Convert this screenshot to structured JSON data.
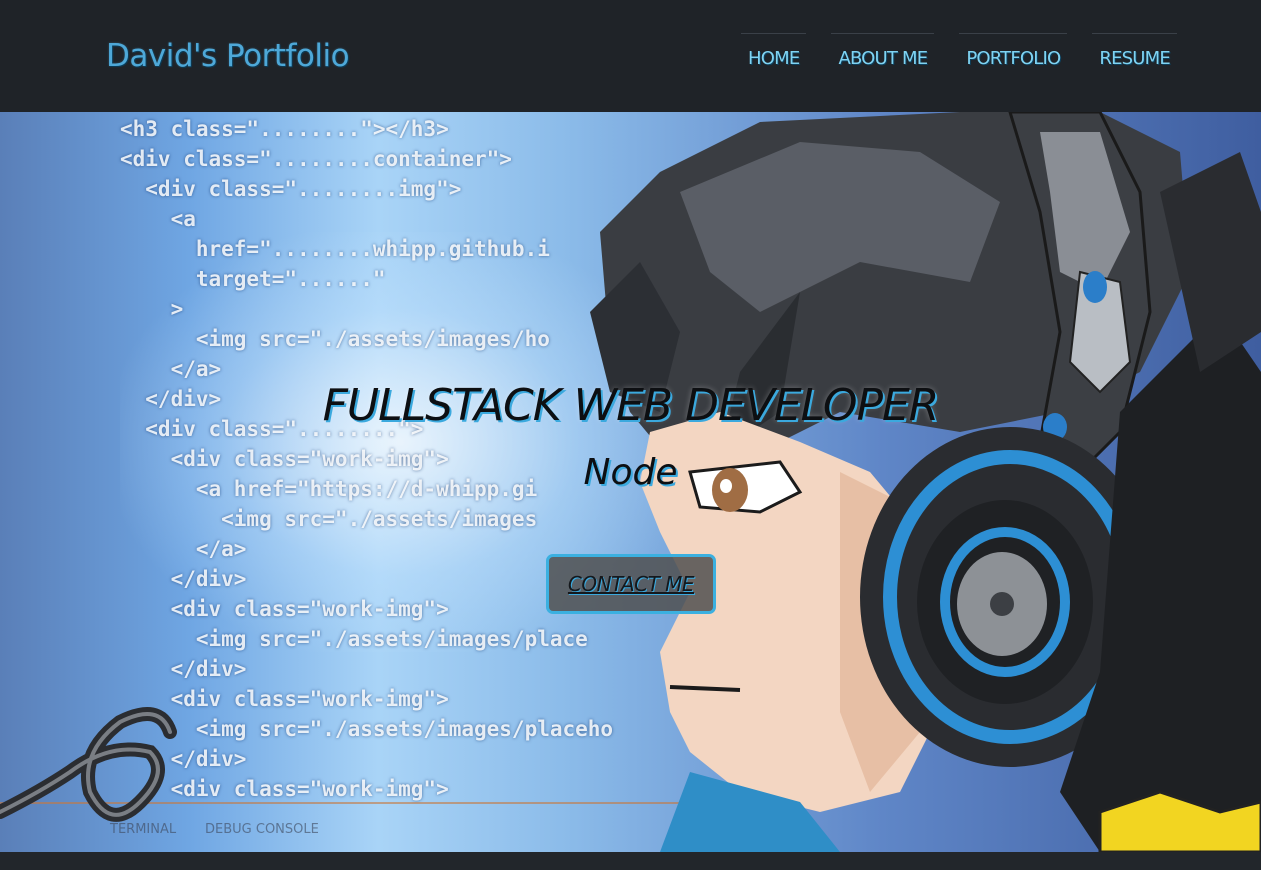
{
  "header": {
    "brand": "David's Portfolio",
    "nav": [
      {
        "label": "HOME"
      },
      {
        "label": "ABOUT ME"
      },
      {
        "label": "PORTFOLIO"
      },
      {
        "label": "RESUME"
      }
    ]
  },
  "hero": {
    "headline": "FULLSTACK WEB DEVELOPER",
    "subline": "Node",
    "contact_label": "CONTACT ME",
    "background_terminal": {
      "tab1": "TERMINAL",
      "tab2": "DEBUG CONSOLE"
    }
  },
  "colors": {
    "accent": "#3ba9de",
    "nav_text": "#7fd3f2",
    "header_bg": "#1f2328"
  }
}
